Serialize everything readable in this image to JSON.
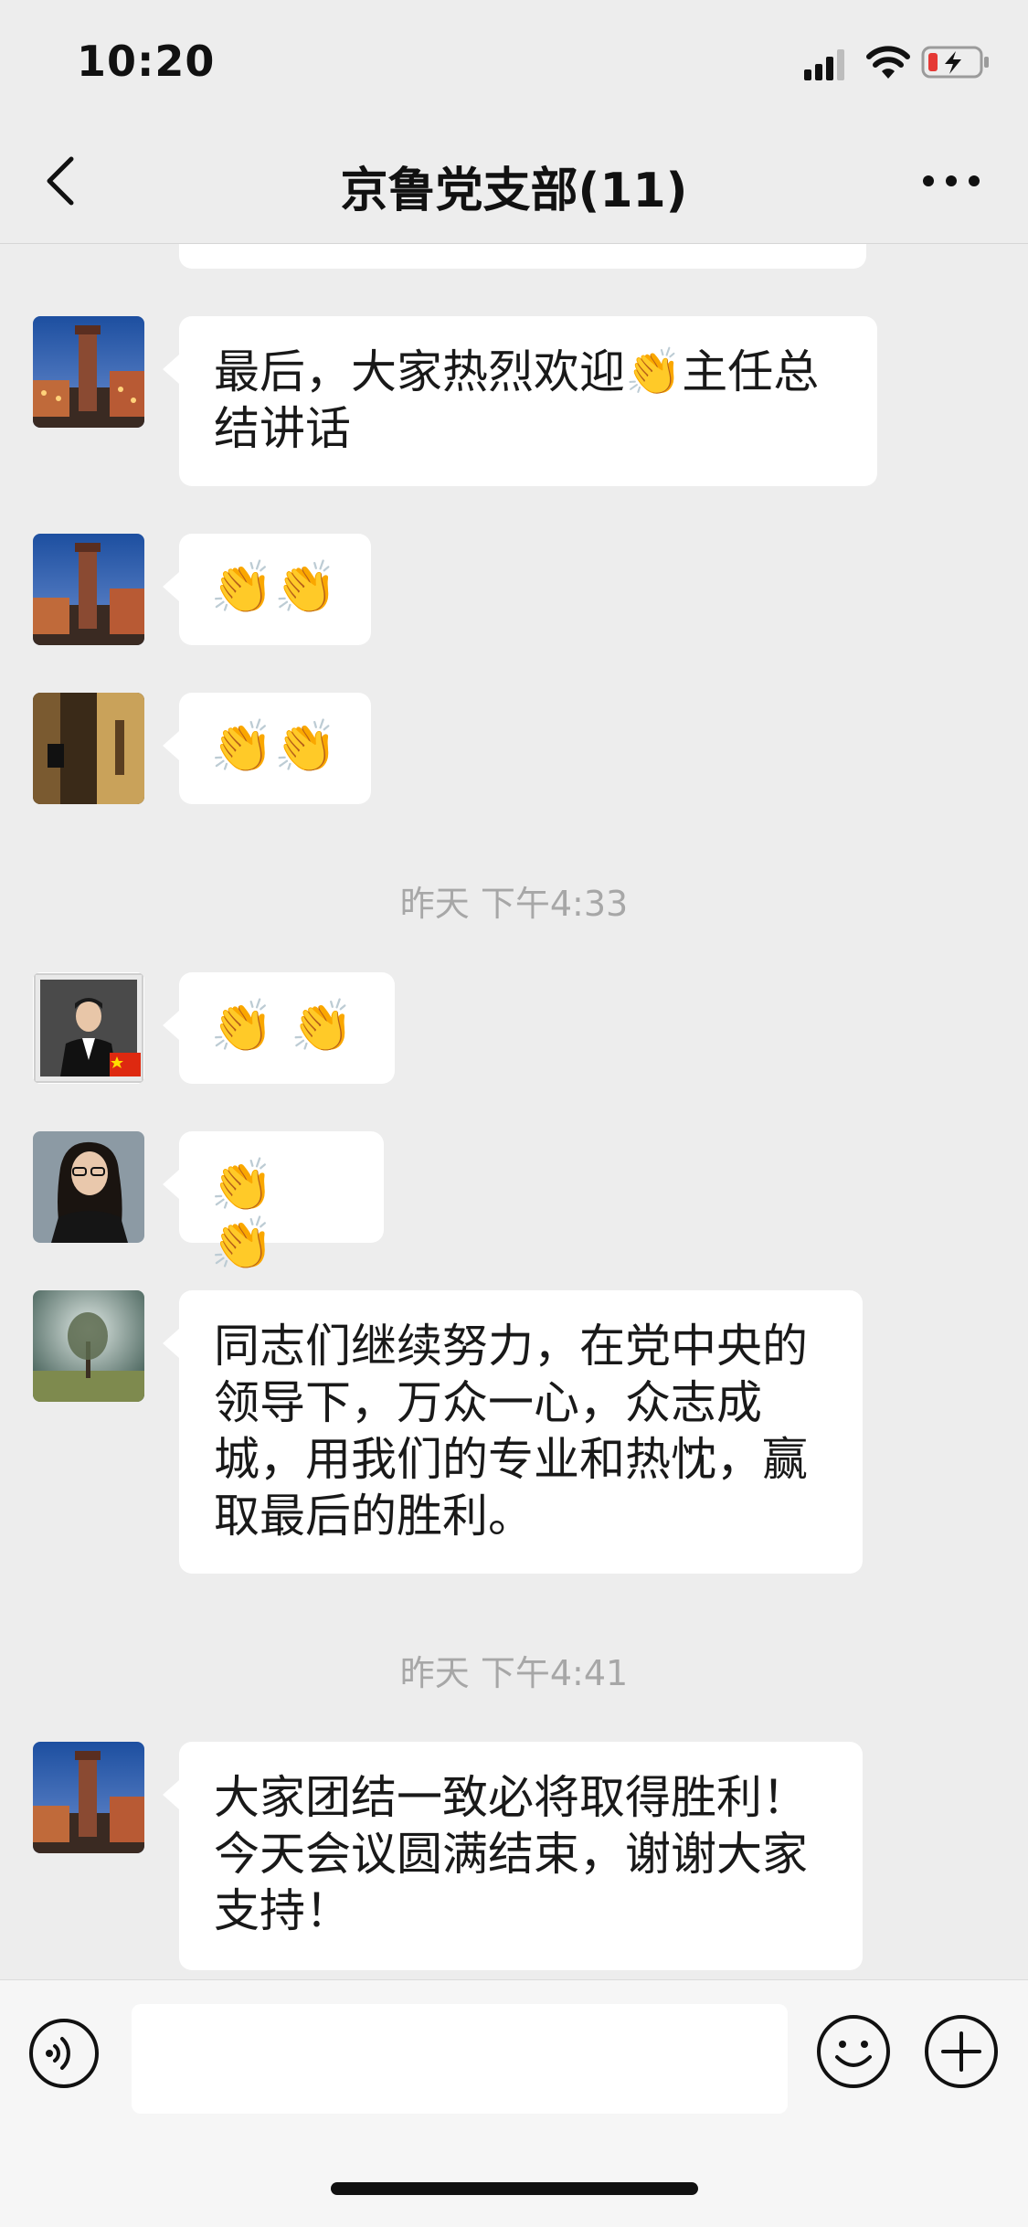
{
  "status_bar": {
    "time": "10:20"
  },
  "header": {
    "title": "京鲁党支部(11)"
  },
  "messages": [
    {
      "text": "最后，大家热烈欢迎👏主任总结讲话"
    },
    {
      "text": "👏👏"
    },
    {
      "text": "👏👏"
    },
    {
      "text": "👏 👏"
    },
    {
      "text": "👏 👏"
    },
    {
      "text": "同志们继续努力，在党中央的领导下，万众一心，众志成城，用我们的专业和热忱，赢取最后的胜利。"
    },
    {
      "text": "大家团结一致必将取得胜利！今天会议圆满结束，谢谢大家支持！"
    }
  ],
  "timestamps": [
    {
      "text": "昨天 下午4:33"
    },
    {
      "text": "昨天 下午4:41"
    }
  ],
  "colors": {
    "background": "#ededed",
    "bubble": "#ffffff",
    "timestamp": "#a7a7a7"
  }
}
